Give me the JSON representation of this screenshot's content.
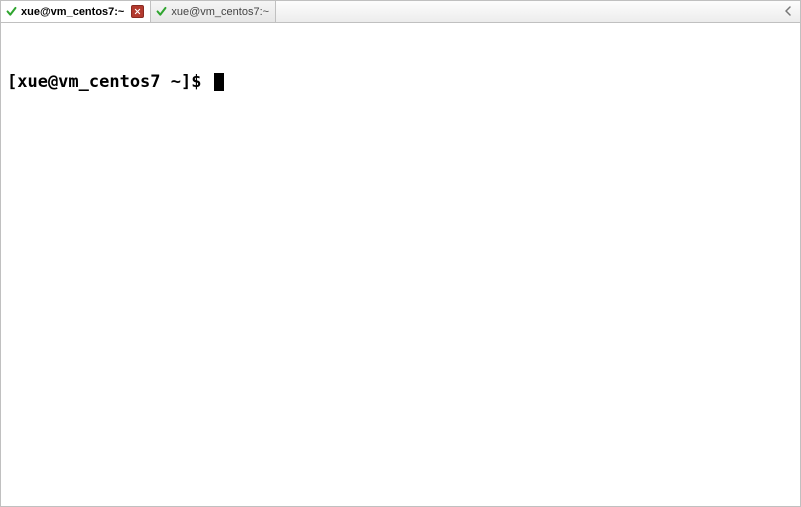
{
  "tabs": {
    "active": {
      "label": "xue@vm_centos7:~"
    },
    "inactive": {
      "label": "xue@vm_centos7:~"
    }
  },
  "terminal": {
    "prompt": "[xue@vm_centos7 ~]$ "
  }
}
